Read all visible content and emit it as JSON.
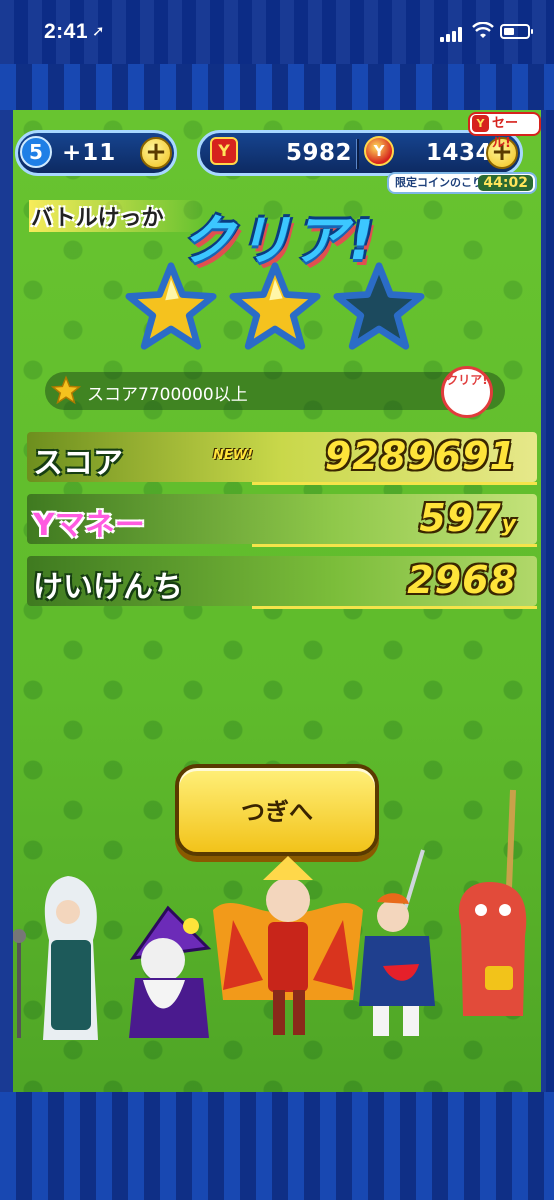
{
  "status_bar": {
    "time": "2:41",
    "location_arrow": "location-arrow-icon",
    "icons": [
      "signal-icon",
      "wifi-icon",
      "battery-icon"
    ]
  },
  "resources": {
    "stamina_icon_label": "5",
    "stamina_bonus": "+11",
    "money_value": "5982",
    "coin_value": "14345",
    "sale_label": "セール!",
    "limited_coin_label": "限定コインのこり",
    "limited_coin_timer": "44:02"
  },
  "result": {
    "header_label": "バトルけっか",
    "title": "クリア!",
    "stars": [
      {
        "earned": true
      },
      {
        "earned": true
      },
      {
        "earned": false
      }
    ],
    "condition_text": "スコア7700000以上",
    "condition_stamp": "クリア!"
  },
  "rows": {
    "score": {
      "label": "スコア",
      "value": "9289691",
      "badge": "NEW!"
    },
    "money": {
      "label": "Yマネー",
      "value": "597",
      "unit": "y"
    },
    "exp": {
      "label": "けいけんち",
      "value": "2968"
    }
  },
  "next_button": {
    "label": "つぎへ"
  },
  "colors": {
    "accent_yellow": "#ffe43a",
    "background_green": "#63bf2c",
    "frame_blue": "#0d2f8e",
    "star_gold": "#f5c21e",
    "star_empty": "#1c4a5e"
  }
}
